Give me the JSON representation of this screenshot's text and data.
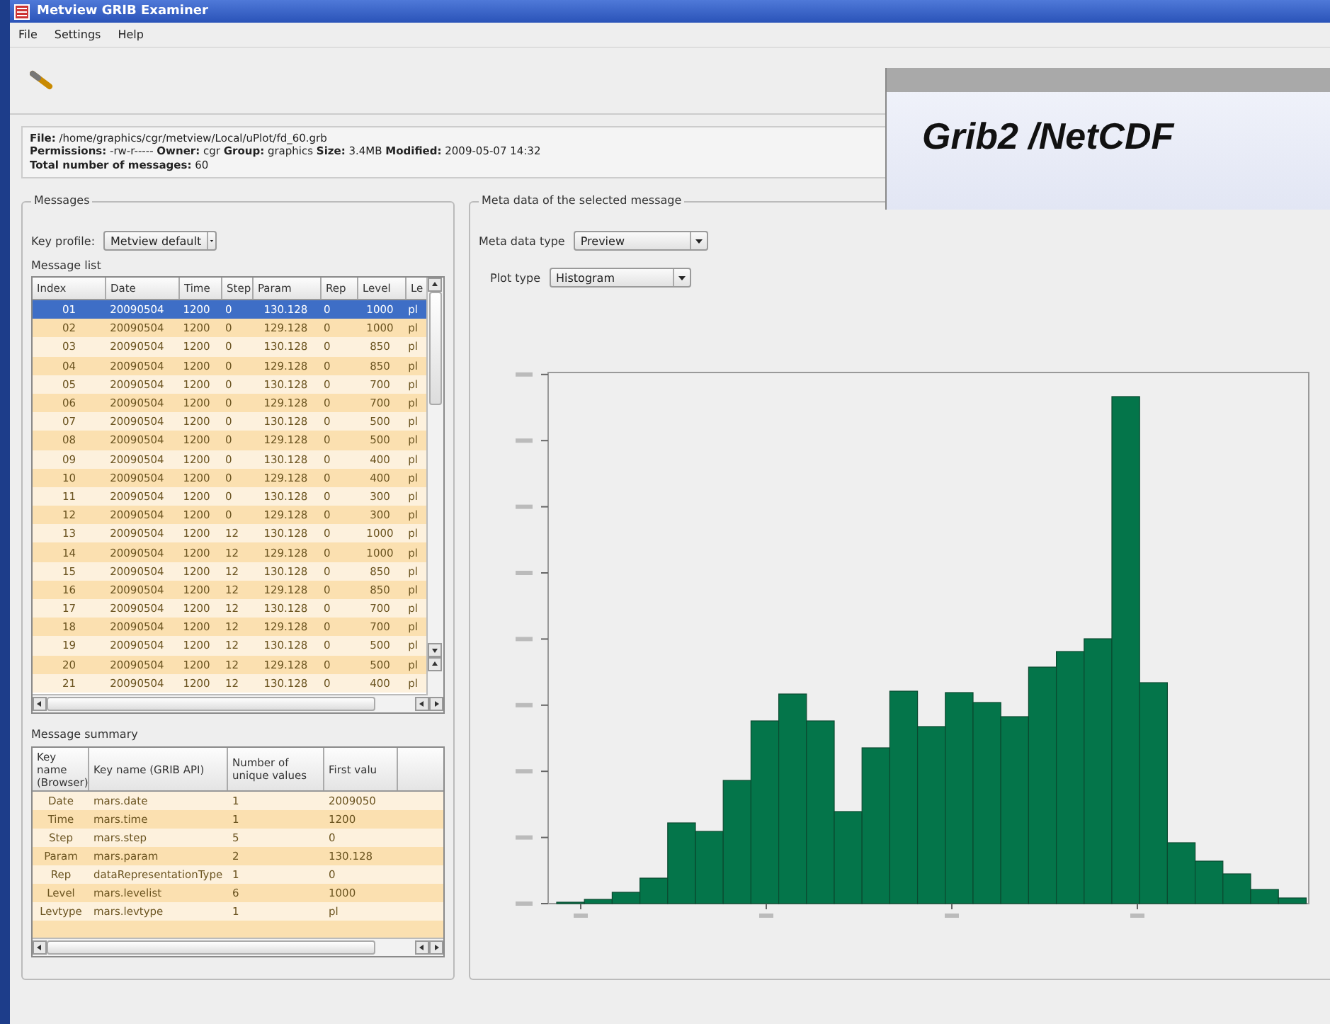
{
  "window": {
    "title": "Metview GRIB Examiner"
  },
  "menu": [
    "File",
    "Settings",
    "Help"
  ],
  "file_info": [
    "**File:** /home/graphics/cgr/metview/Local/uPlot/fd_60.grb",
    "**Permissions:** -rw-r----- **Owner:** cgr **Group:** graphics **Size:** 3.4MB **Modified:** 2009-05-07 14:32",
    "**Total number of messages:** 60"
  ],
  "messages": {
    "title": "Messages",
    "key_profile": {
      "label": "Key profile:",
      "value": "Metview default"
    },
    "list_label": "Message list",
    "columns": [
      "Index",
      "Date",
      "Time",
      "Step",
      "Param",
      "Rep",
      "Level",
      "Le"
    ],
    "rows": [
      {
        "cells": [
          "01",
          "20090504",
          "1200",
          "0",
          "130.128",
          "0",
          "1000",
          "pl"
        ],
        "selected": true
      },
      {
        "cells": [
          "02",
          "20090504",
          "1200",
          "0",
          "129.128",
          "0",
          "1000",
          "pl"
        ],
        "selected": false
      },
      {
        "cells": [
          "03",
          "20090504",
          "1200",
          "0",
          "130.128",
          "0",
          "850",
          "pl"
        ],
        "selected": false
      },
      {
        "cells": [
          "04",
          "20090504",
          "1200",
          "0",
          "129.128",
          "0",
          "850",
          "pl"
        ],
        "selected": false
      },
      {
        "cells": [
          "05",
          "20090504",
          "1200",
          "0",
          "130.128",
          "0",
          "700",
          "pl"
        ],
        "selected": false
      },
      {
        "cells": [
          "06",
          "20090504",
          "1200",
          "0",
          "129.128",
          "0",
          "700",
          "pl"
        ],
        "selected": false
      },
      {
        "cells": [
          "07",
          "20090504",
          "1200",
          "0",
          "130.128",
          "0",
          "500",
          "pl"
        ],
        "selected": false
      },
      {
        "cells": [
          "08",
          "20090504",
          "1200",
          "0",
          "129.128",
          "0",
          "500",
          "pl"
        ],
        "selected": false
      },
      {
        "cells": [
          "09",
          "20090504",
          "1200",
          "0",
          "130.128",
          "0",
          "400",
          "pl"
        ],
        "selected": false
      },
      {
        "cells": [
          "10",
          "20090504",
          "1200",
          "0",
          "129.128",
          "0",
          "400",
          "pl"
        ],
        "selected": false
      },
      {
        "cells": [
          "11",
          "20090504",
          "1200",
          "0",
          "130.128",
          "0",
          "300",
          "pl"
        ],
        "selected": false
      },
      {
        "cells": [
          "12",
          "20090504",
          "1200",
          "0",
          "129.128",
          "0",
          "300",
          "pl"
        ],
        "selected": false
      },
      {
        "cells": [
          "13",
          "20090504",
          "1200",
          "12",
          "130.128",
          "0",
          "1000",
          "pl"
        ],
        "selected": false
      },
      {
        "cells": [
          "14",
          "20090504",
          "1200",
          "12",
          "129.128",
          "0",
          "1000",
          "pl"
        ],
        "selected": false
      },
      {
        "cells": [
          "15",
          "20090504",
          "1200",
          "12",
          "130.128",
          "0",
          "850",
          "pl"
        ],
        "selected": false
      },
      {
        "cells": [
          "16",
          "20090504",
          "1200",
          "12",
          "129.128",
          "0",
          "850",
          "pl"
        ],
        "selected": false
      },
      {
        "cells": [
          "17",
          "20090504",
          "1200",
          "12",
          "130.128",
          "0",
          "700",
          "pl"
        ],
        "selected": false
      },
      {
        "cells": [
          "18",
          "20090504",
          "1200",
          "12",
          "129.128",
          "0",
          "700",
          "pl"
        ],
        "selected": false
      },
      {
        "cells": [
          "19",
          "20090504",
          "1200",
          "12",
          "130.128",
          "0",
          "500",
          "pl"
        ],
        "selected": false
      },
      {
        "cells": [
          "20",
          "20090504",
          "1200",
          "12",
          "129.128",
          "0",
          "500",
          "pl"
        ],
        "selected": false
      },
      {
        "cells": [
          "21",
          "20090504",
          "1200",
          "12",
          "130.128",
          "0",
          "400",
          "pl"
        ],
        "selected": false
      }
    ]
  },
  "summary": {
    "title": "Message summary",
    "columns": [
      "Key name (Browser)",
      "Key name (GRIB API)",
      "Number of unique values",
      "First valu"
    ],
    "rows": [
      {
        "cells": [
          "Date",
          "mars.date",
          "1",
          "2009050"
        ]
      },
      {
        "cells": [
          "Time",
          "mars.time",
          "1",
          "1200"
        ]
      },
      {
        "cells": [
          "Step",
          "mars.step",
          "5",
          "0"
        ]
      },
      {
        "cells": [
          "Param",
          "mars.param",
          "2",
          "130.128"
        ]
      },
      {
        "cells": [
          "Rep",
          "dataRepresentationType",
          "1",
          "0"
        ]
      },
      {
        "cells": [
          "Level",
          "mars.levelist",
          "6",
          "1000"
        ]
      },
      {
        "cells": [
          "Levtype",
          "mars.levtype",
          "1",
          "pl"
        ]
      }
    ]
  },
  "meta": {
    "title": "Meta data of the selected message",
    "meta_type": {
      "label": "Meta data type",
      "value": "Preview"
    },
    "plot_type": {
      "label": "Plot type",
      "value": "Histogram"
    }
  },
  "banner": {
    "text": "Grib2 /NetCDF"
  }
}
